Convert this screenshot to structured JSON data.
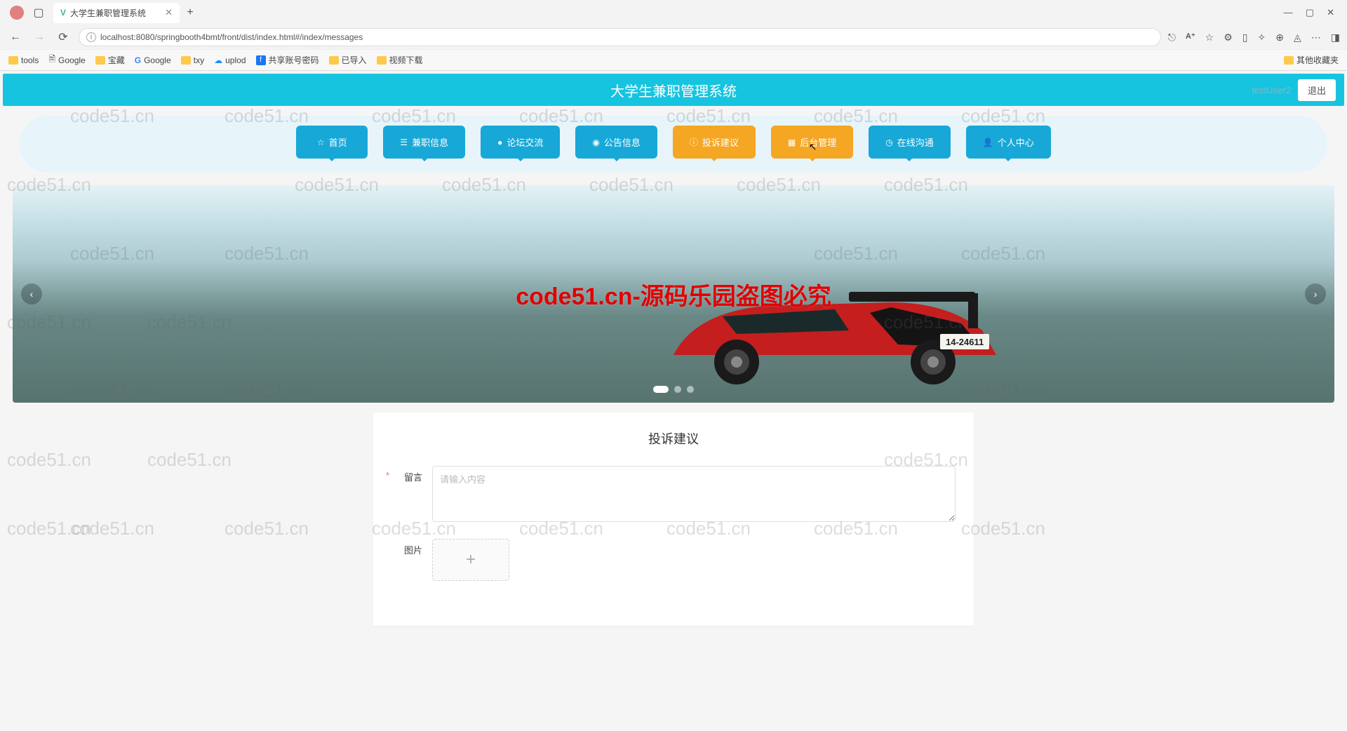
{
  "browser": {
    "tab_title": "大学生兼职管理系统",
    "url": "localhost:8080/springbooth4bmt/front/dist/index.html#/index/messages",
    "new_tab": "+"
  },
  "bookmarks": {
    "items": [
      {
        "label": "tools",
        "type": "folder"
      },
      {
        "label": "Google",
        "type": "page"
      },
      {
        "label": "宝藏",
        "type": "folder"
      },
      {
        "label": "Google",
        "type": "g"
      },
      {
        "label": "txy",
        "type": "folder"
      },
      {
        "label": "uplod",
        "type": "cloud"
      },
      {
        "label": "共享账号密码",
        "type": "fb"
      },
      {
        "label": "已导入",
        "type": "folder"
      },
      {
        "label": "视频下载",
        "type": "folder"
      }
    ],
    "right": "其他收藏夹"
  },
  "header": {
    "title": "大学生兼职管理系统",
    "user": "testUser2",
    "logout": "退出"
  },
  "nav": {
    "items": [
      {
        "icon": "☆",
        "label": "首页",
        "state": ""
      },
      {
        "icon": "☰",
        "label": "兼职信息",
        "state": ""
      },
      {
        "icon": "●",
        "label": "论坛交流",
        "state": ""
      },
      {
        "icon": "◉",
        "label": "公告信息",
        "state": ""
      },
      {
        "icon": "ⓘ",
        "label": "投诉建议",
        "state": "active"
      },
      {
        "icon": "▦",
        "label": "后台管理",
        "state": "hover"
      },
      {
        "icon": "◷",
        "label": "在线沟通",
        "state": ""
      },
      {
        "icon": "👤",
        "label": "个人中心",
        "state": ""
      }
    ]
  },
  "banner": {
    "overlay_text": "code51.cn-源码乐园盗图必究"
  },
  "form": {
    "title": "投诉建议",
    "message_label": "留言",
    "message_placeholder": "请输入内容",
    "image_label": "图片",
    "upload_plus": "+"
  },
  "watermark": "code51.cn"
}
